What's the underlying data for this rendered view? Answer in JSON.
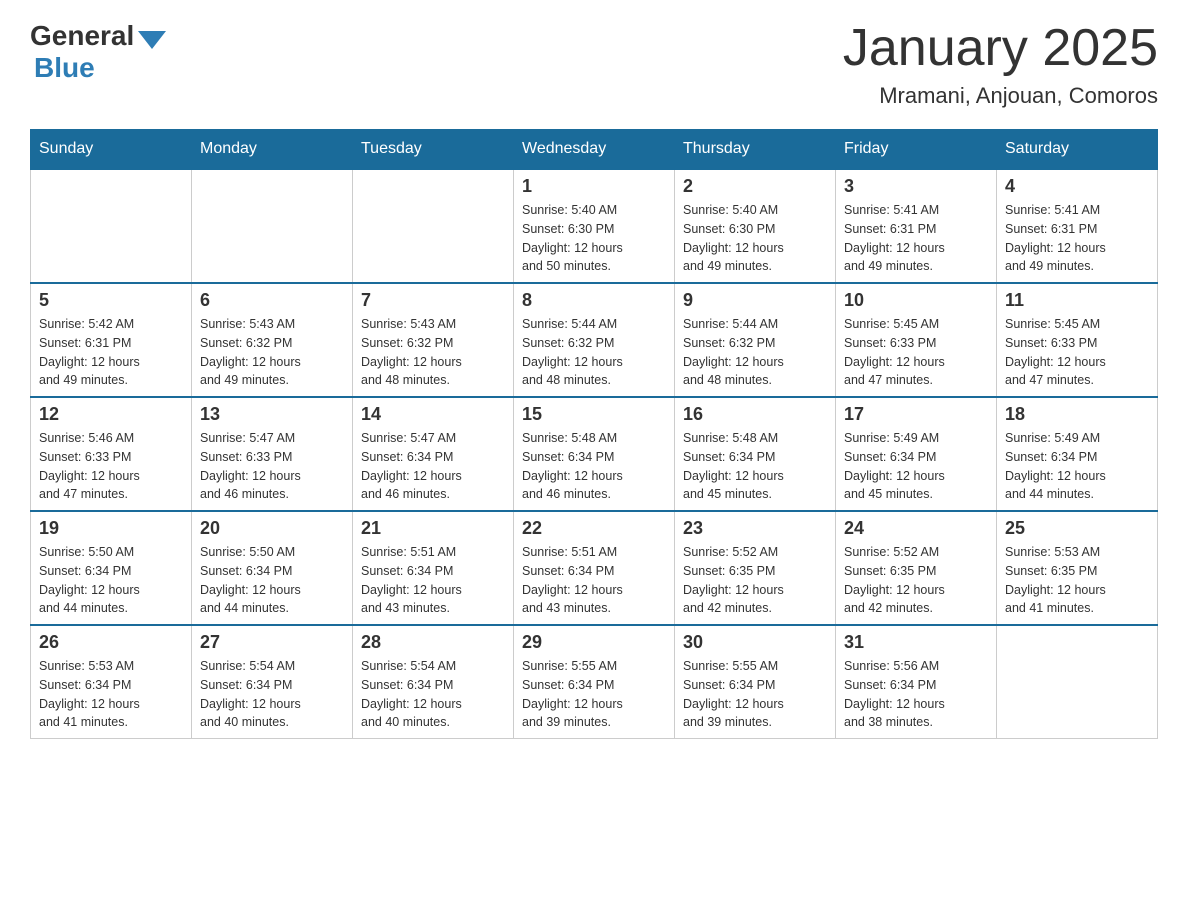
{
  "header": {
    "logo_general": "General",
    "logo_blue": "Blue",
    "title": "January 2025",
    "subtitle": "Mramani, Anjouan, Comoros"
  },
  "calendar": {
    "days_of_week": [
      "Sunday",
      "Monday",
      "Tuesday",
      "Wednesday",
      "Thursday",
      "Friday",
      "Saturday"
    ],
    "weeks": [
      [
        {
          "day": "",
          "info": ""
        },
        {
          "day": "",
          "info": ""
        },
        {
          "day": "",
          "info": ""
        },
        {
          "day": "1",
          "info": "Sunrise: 5:40 AM\nSunset: 6:30 PM\nDaylight: 12 hours\nand 50 minutes."
        },
        {
          "day": "2",
          "info": "Sunrise: 5:40 AM\nSunset: 6:30 PM\nDaylight: 12 hours\nand 49 minutes."
        },
        {
          "day": "3",
          "info": "Sunrise: 5:41 AM\nSunset: 6:31 PM\nDaylight: 12 hours\nand 49 minutes."
        },
        {
          "day": "4",
          "info": "Sunrise: 5:41 AM\nSunset: 6:31 PM\nDaylight: 12 hours\nand 49 minutes."
        }
      ],
      [
        {
          "day": "5",
          "info": "Sunrise: 5:42 AM\nSunset: 6:31 PM\nDaylight: 12 hours\nand 49 minutes."
        },
        {
          "day": "6",
          "info": "Sunrise: 5:43 AM\nSunset: 6:32 PM\nDaylight: 12 hours\nand 49 minutes."
        },
        {
          "day": "7",
          "info": "Sunrise: 5:43 AM\nSunset: 6:32 PM\nDaylight: 12 hours\nand 48 minutes."
        },
        {
          "day": "8",
          "info": "Sunrise: 5:44 AM\nSunset: 6:32 PM\nDaylight: 12 hours\nand 48 minutes."
        },
        {
          "day": "9",
          "info": "Sunrise: 5:44 AM\nSunset: 6:32 PM\nDaylight: 12 hours\nand 48 minutes."
        },
        {
          "day": "10",
          "info": "Sunrise: 5:45 AM\nSunset: 6:33 PM\nDaylight: 12 hours\nand 47 minutes."
        },
        {
          "day": "11",
          "info": "Sunrise: 5:45 AM\nSunset: 6:33 PM\nDaylight: 12 hours\nand 47 minutes."
        }
      ],
      [
        {
          "day": "12",
          "info": "Sunrise: 5:46 AM\nSunset: 6:33 PM\nDaylight: 12 hours\nand 47 minutes."
        },
        {
          "day": "13",
          "info": "Sunrise: 5:47 AM\nSunset: 6:33 PM\nDaylight: 12 hours\nand 46 minutes."
        },
        {
          "day": "14",
          "info": "Sunrise: 5:47 AM\nSunset: 6:34 PM\nDaylight: 12 hours\nand 46 minutes."
        },
        {
          "day": "15",
          "info": "Sunrise: 5:48 AM\nSunset: 6:34 PM\nDaylight: 12 hours\nand 46 minutes."
        },
        {
          "day": "16",
          "info": "Sunrise: 5:48 AM\nSunset: 6:34 PM\nDaylight: 12 hours\nand 45 minutes."
        },
        {
          "day": "17",
          "info": "Sunrise: 5:49 AM\nSunset: 6:34 PM\nDaylight: 12 hours\nand 45 minutes."
        },
        {
          "day": "18",
          "info": "Sunrise: 5:49 AM\nSunset: 6:34 PM\nDaylight: 12 hours\nand 44 minutes."
        }
      ],
      [
        {
          "day": "19",
          "info": "Sunrise: 5:50 AM\nSunset: 6:34 PM\nDaylight: 12 hours\nand 44 minutes."
        },
        {
          "day": "20",
          "info": "Sunrise: 5:50 AM\nSunset: 6:34 PM\nDaylight: 12 hours\nand 44 minutes."
        },
        {
          "day": "21",
          "info": "Sunrise: 5:51 AM\nSunset: 6:34 PM\nDaylight: 12 hours\nand 43 minutes."
        },
        {
          "day": "22",
          "info": "Sunrise: 5:51 AM\nSunset: 6:34 PM\nDaylight: 12 hours\nand 43 minutes."
        },
        {
          "day": "23",
          "info": "Sunrise: 5:52 AM\nSunset: 6:35 PM\nDaylight: 12 hours\nand 42 minutes."
        },
        {
          "day": "24",
          "info": "Sunrise: 5:52 AM\nSunset: 6:35 PM\nDaylight: 12 hours\nand 42 minutes."
        },
        {
          "day": "25",
          "info": "Sunrise: 5:53 AM\nSunset: 6:35 PM\nDaylight: 12 hours\nand 41 minutes."
        }
      ],
      [
        {
          "day": "26",
          "info": "Sunrise: 5:53 AM\nSunset: 6:34 PM\nDaylight: 12 hours\nand 41 minutes."
        },
        {
          "day": "27",
          "info": "Sunrise: 5:54 AM\nSunset: 6:34 PM\nDaylight: 12 hours\nand 40 minutes."
        },
        {
          "day": "28",
          "info": "Sunrise: 5:54 AM\nSunset: 6:34 PM\nDaylight: 12 hours\nand 40 minutes."
        },
        {
          "day": "29",
          "info": "Sunrise: 5:55 AM\nSunset: 6:34 PM\nDaylight: 12 hours\nand 39 minutes."
        },
        {
          "day": "30",
          "info": "Sunrise: 5:55 AM\nSunset: 6:34 PM\nDaylight: 12 hours\nand 39 minutes."
        },
        {
          "day": "31",
          "info": "Sunrise: 5:56 AM\nSunset: 6:34 PM\nDaylight: 12 hours\nand 38 minutes."
        },
        {
          "day": "",
          "info": ""
        }
      ]
    ]
  }
}
